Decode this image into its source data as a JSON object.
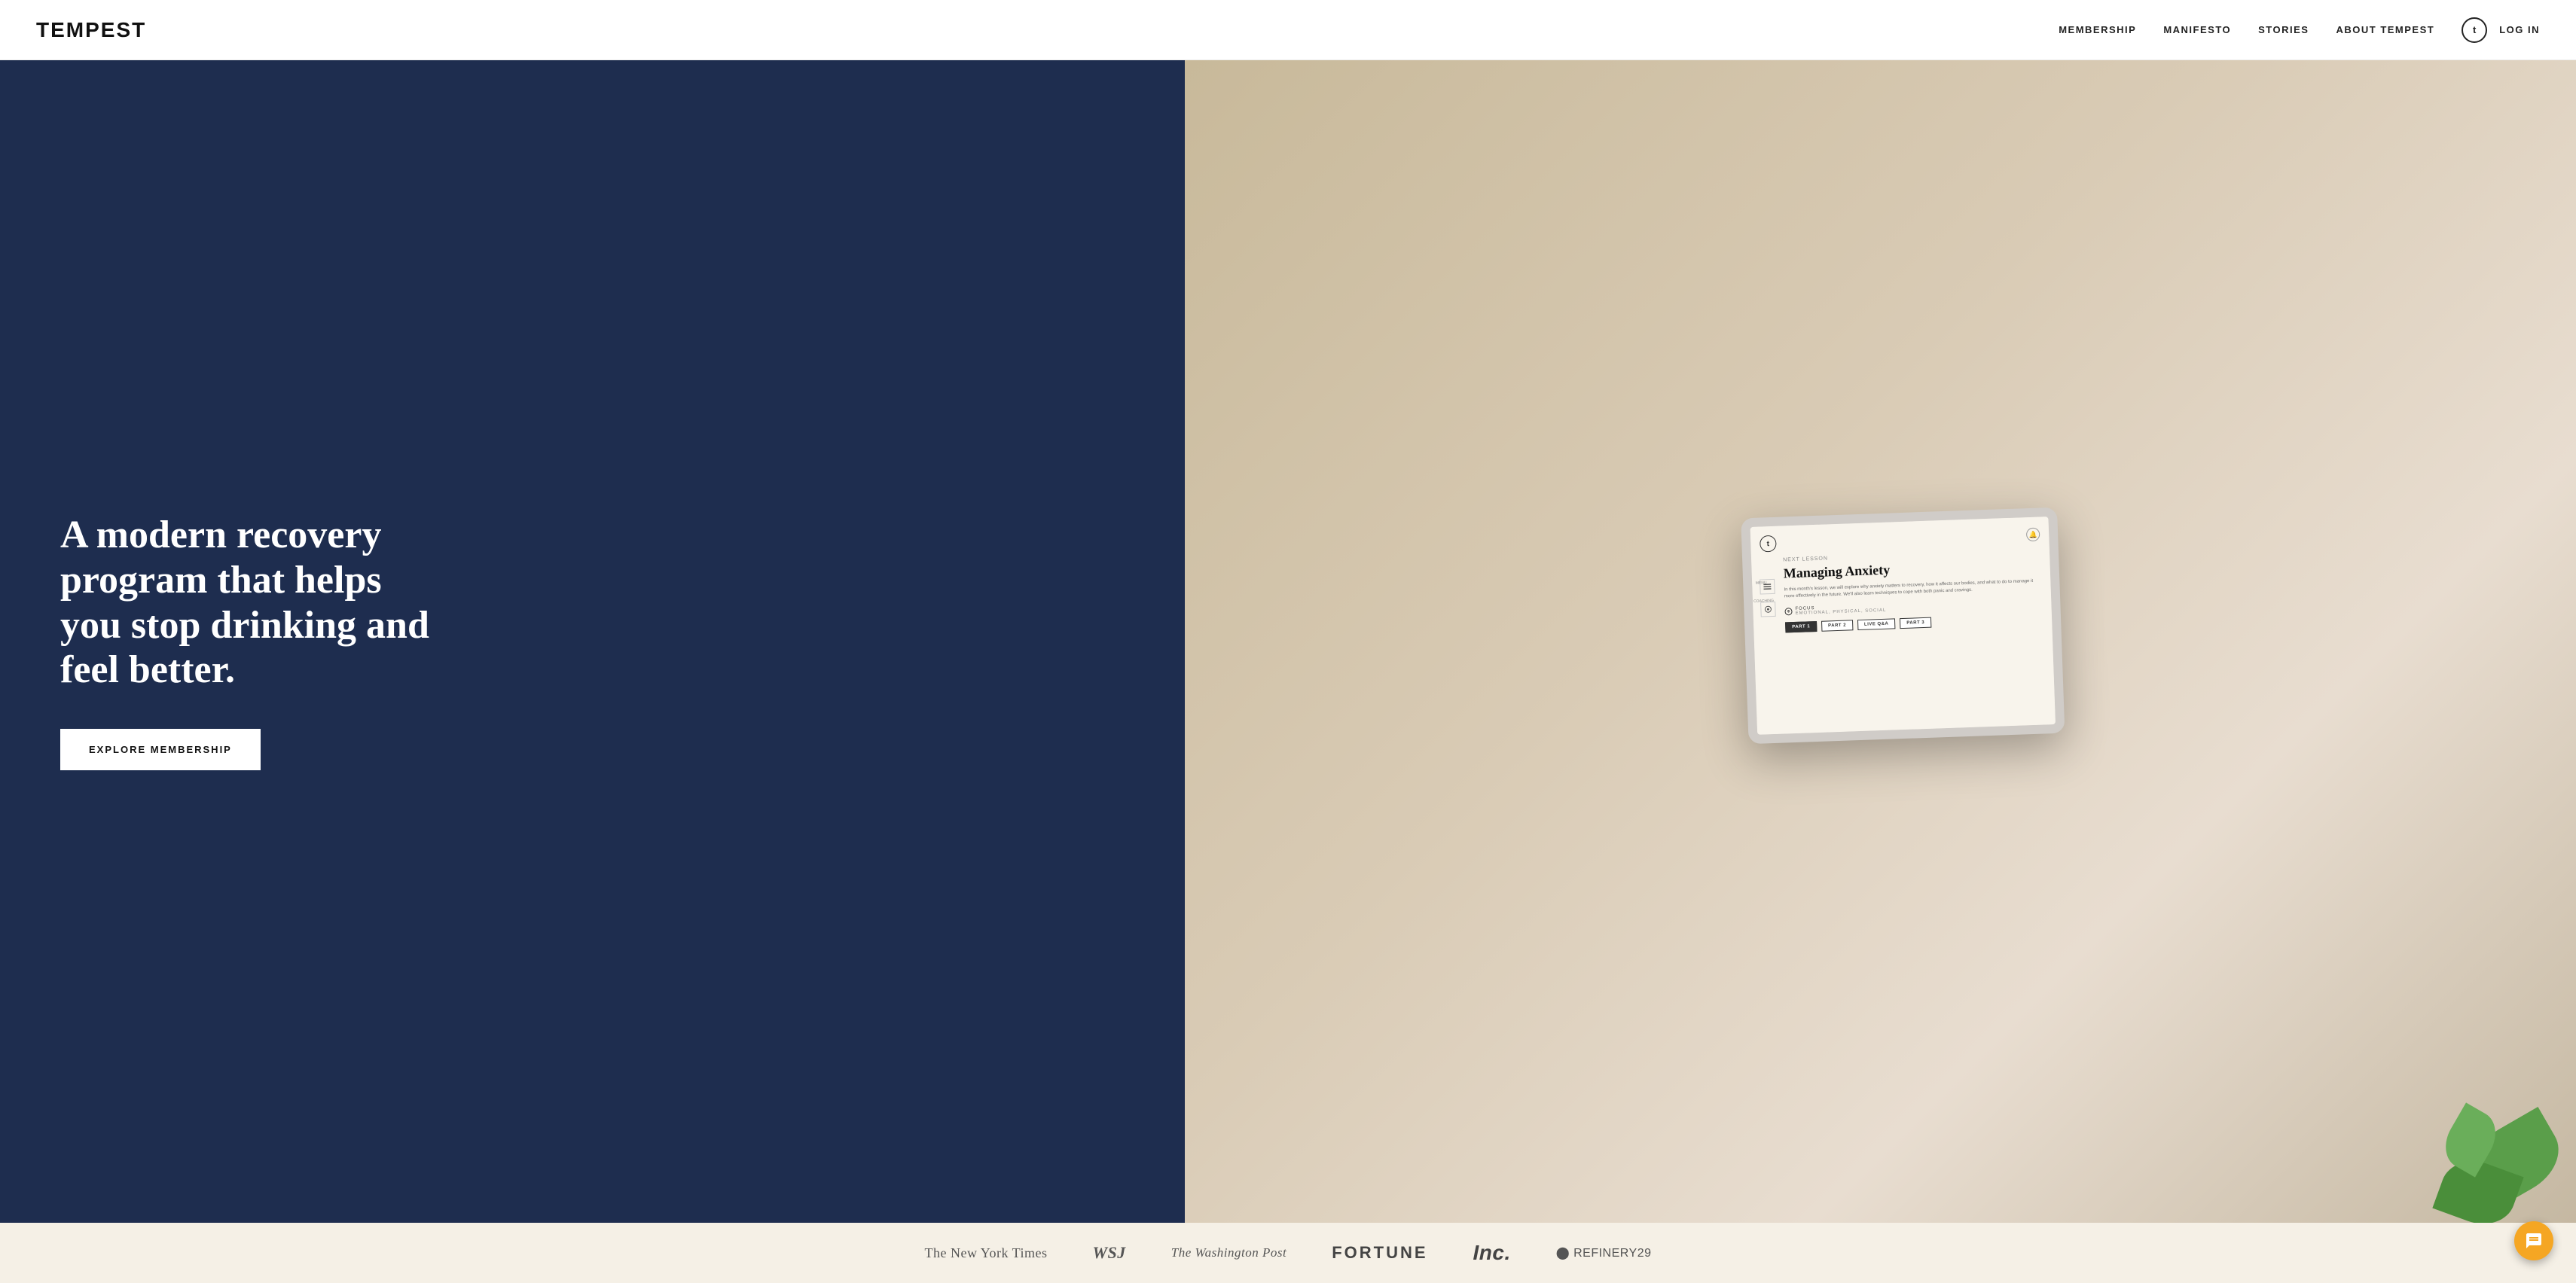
{
  "header": {
    "logo": "TEMPEST",
    "nav": {
      "items": [
        {
          "id": "membership",
          "label": "MEMBERSHIP"
        },
        {
          "id": "manifesto",
          "label": "MANIFESTO"
        },
        {
          "id": "stories",
          "label": "STORIES"
        },
        {
          "id": "about",
          "label": "ABOUT TEMPEST"
        }
      ],
      "login_icon_label": "t",
      "login_label": "LOG IN"
    }
  },
  "hero": {
    "heading": "A modern recovery program that helps you stop drinking and feel better.",
    "cta_label": "EXPLORE MEMBERSHIP",
    "tablet": {
      "next_lesson_label": "NEXT LESSON",
      "lesson_title": "Managing Anxiety",
      "lesson_description": "In this month's lesson, we will explore why anxiety matters to recovery, how it affects our bodies, and what to do to manage it more effectively in the future. We'll also learn techniques to cope with both panic and cravings.",
      "focus_label": "FOCUS",
      "focus_areas": "EMOTIONAL, PHYSICAL, SOCIAL",
      "parts": [
        {
          "label": "PART 1",
          "active": true
        },
        {
          "label": "PART 2",
          "active": false
        },
        {
          "label": "LIVE Q&A",
          "active": false
        },
        {
          "label": "PART 3",
          "active": false
        }
      ],
      "sidebar_items": [
        {
          "label": "MENU"
        },
        {
          "label": "COACHING"
        }
      ]
    }
  },
  "media_bar": {
    "logos": [
      {
        "id": "nyt",
        "text": "The New York Times",
        "style": "nyt"
      },
      {
        "id": "wsj",
        "text": "WSJ",
        "style": "wsj"
      },
      {
        "id": "wapo",
        "text": "The Washington Post",
        "style": "wapo"
      },
      {
        "id": "fortune",
        "text": "FORTUNE",
        "style": "fortune"
      },
      {
        "id": "inc",
        "text": "Inc.",
        "style": "inc"
      },
      {
        "id": "r29",
        "text": "⬤ REFINERY29",
        "style": "r29"
      }
    ]
  },
  "chat": {
    "icon_label": "chat"
  }
}
